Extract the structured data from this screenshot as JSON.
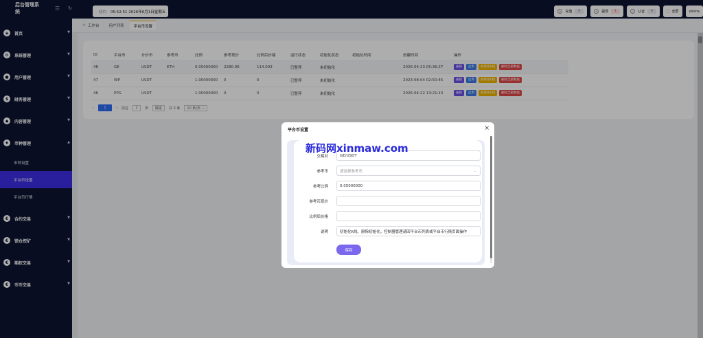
{
  "sidebar": {
    "app_title": "后台管理系统",
    "items": [
      {
        "label": "首页",
        "icon": "shield-icon"
      },
      {
        "label": "系统管理",
        "icon": "gear-icon"
      },
      {
        "label": "用户管理",
        "icon": "user-icon"
      },
      {
        "label": "财务管理",
        "icon": "money-icon"
      },
      {
        "label": "内容管理",
        "icon": "tag-icon"
      },
      {
        "label": "币种管理",
        "icon": "diamond-icon"
      },
      {
        "label": "合约交易",
        "icon": "coin-icon"
      },
      {
        "label": "锁仓挖矿",
        "icon": "coin-icon"
      },
      {
        "label": "期权交易",
        "icon": "coin-icon"
      },
      {
        "label": "币币交易",
        "icon": "coin-icon"
      }
    ],
    "subitems": [
      "币种设置",
      "平台币设置",
      "平台币行情"
    ]
  },
  "topbar": {
    "date_label": "纽约:",
    "datetime": "05:52:51 2026年6月1日星期五",
    "buttons": [
      {
        "label": "充值",
        "badge": "0"
      },
      {
        "label": "提现",
        "badge": "1"
      },
      {
        "label": "认证",
        "badge": "0"
      },
      {
        "label": "全屏",
        "badge": ""
      },
      {
        "label": "xinma",
        "badge": ""
      }
    ]
  },
  "tabs": [
    "工作台",
    "用户列表",
    "平台币设置"
  ],
  "table": {
    "headers": [
      "ID",
      "平台币",
      "计价币",
      "参考币",
      "比例",
      "参考现价",
      "比例后价格",
      "运行状态",
      "初始化状态",
      "初始化时间",
      "创建时间",
      "操作"
    ],
    "rows": [
      [
        "48",
        "GE",
        "USDT",
        "ETH",
        "0.05000000",
        "2280.06",
        "114.003",
        "已暂停",
        "未初始化",
        "",
        "2026-04-23 05:36:27"
      ],
      [
        "47",
        "WP",
        "USDT",
        "",
        "1.00000000",
        "0",
        "0",
        "已暂停",
        "未初始化",
        "",
        "2023-08-04 02:50:45"
      ],
      [
        "46",
        "PPG",
        "USDT",
        "",
        "1.00000000",
        "0",
        "0",
        "已暂停",
        "未初始化",
        "",
        "2026-04-22 13:21:13"
      ]
    ],
    "actions": [
      "编辑",
      "启用",
      "初始化K线",
      "删除全部数据"
    ]
  },
  "pager": {
    "page": "1",
    "goto_label": "前往",
    "page_input": "1",
    "page_unit": "页",
    "go": "确定",
    "total": "共 3 条",
    "size": "10 条/页"
  },
  "dialog": {
    "title": "平台币设置",
    "fields": [
      {
        "label": "交易对",
        "value": "GE/USDT",
        "placeholder": ""
      },
      {
        "label": "参考币",
        "value": "",
        "placeholder": "请选择参考币"
      },
      {
        "label": "参考比例",
        "value": "0.05000000",
        "placeholder": ""
      },
      {
        "label": "参考币现价",
        "value": "",
        "placeholder": ""
      },
      {
        "label": "比例后价格",
        "value": "",
        "placeholder": ""
      },
      {
        "label": "说明",
        "value": "初始化K线、删除初始化，控制器管理请回平台币列表或平台币行情页面操作",
        "placeholder": ""
      }
    ],
    "save": "保存"
  },
  "watermark": "新码网xinmaw.com"
}
